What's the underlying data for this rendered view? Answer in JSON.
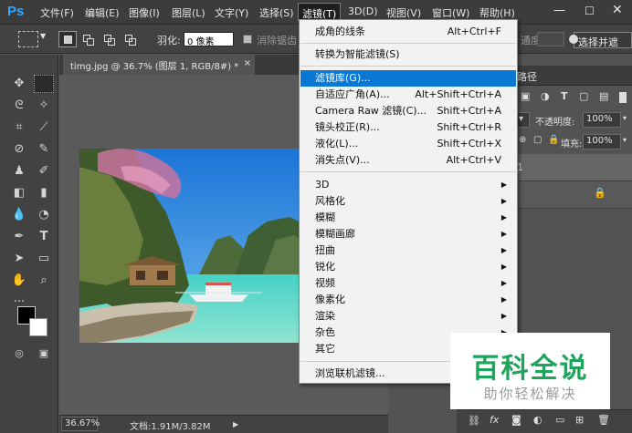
{
  "app": {
    "logo": "Ps",
    "menus": [
      "文件(F)",
      "编辑(E)",
      "图像(I)",
      "图层(L)",
      "文字(Y)",
      "选择(S)",
      "滤镜(T)",
      "3D(D)",
      "视图(V)",
      "窗口(W)",
      "帮助(H)"
    ]
  },
  "options": {
    "feather_label": "羽化:",
    "feather_value": "0 像素",
    "antialias_label": "消除锯齿",
    "select_mask_label": "选择并遮",
    "style_fragment": "通度"
  },
  "document": {
    "tab_title": "timg.jpg @ 36.7% (图层 1, RGB/8#) *",
    "tab_close": "×",
    "zoom": "36.67%",
    "doc_info": "文档:1.91M/3.82M"
  },
  "filter_menu": {
    "items": [
      {
        "label": "成角的线条",
        "shortcut": "Alt+Ctrl+F"
      },
      {
        "label": "转换为智能滤镜(S)",
        "shortcut": ""
      },
      {
        "label": "滤镜库(G)...",
        "shortcut": "",
        "highlighted": true
      },
      {
        "label": "自适应广角(A)...",
        "shortcut": "Alt+Shift+Ctrl+A"
      },
      {
        "label": "Camera Raw 滤镜(C)...",
        "shortcut": "Shift+Ctrl+A"
      },
      {
        "label": "镜头校正(R)...",
        "shortcut": "Shift+Ctrl+R"
      },
      {
        "label": "液化(L)...",
        "shortcut": "Shift+Ctrl+X"
      },
      {
        "label": "消失点(V)...",
        "shortcut": "Alt+Ctrl+V"
      },
      {
        "label": "3D",
        "submenu": true
      },
      {
        "label": "风格化",
        "submenu": true
      },
      {
        "label": "模糊",
        "submenu": true
      },
      {
        "label": "模糊画廊",
        "submenu": true
      },
      {
        "label": "扭曲",
        "submenu": true
      },
      {
        "label": "锐化",
        "submenu": true
      },
      {
        "label": "视频",
        "submenu": true
      },
      {
        "label": "像素化",
        "submenu": true
      },
      {
        "label": "渲染",
        "submenu": true
      },
      {
        "label": "杂色",
        "submenu": true
      },
      {
        "label": "其它",
        "submenu": true
      },
      {
        "label": "浏览联机滤镜...",
        "shortcut": ""
      }
    ]
  },
  "right_panel": {
    "tab_fragment": "路径",
    "opacity_label": "不透明度:",
    "opacity_value": "100%",
    "fill_label": "填充:",
    "fill_value": "100%",
    "layer_fragment": "1"
  },
  "watermark": {
    "title": "百科全说",
    "subtitle": "助你轻松解决"
  },
  "colors": {
    "menu_highlight": "#0978d5",
    "ps_blue": "#31a8ff",
    "watermark_green": "#1fa55b"
  }
}
